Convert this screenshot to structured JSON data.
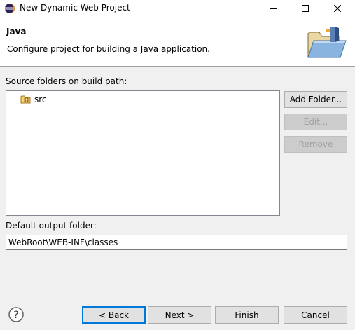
{
  "window": {
    "title": "New Dynamic Web Project",
    "icon": "eclipse-icon",
    "controls": [
      "minimize-icon",
      "maximize-icon",
      "close-icon"
    ]
  },
  "header": {
    "title": "Java",
    "description": "Configure project for building a Java application.",
    "image": "java-folder-icon"
  },
  "source": {
    "label": "Source folders on build path:",
    "items": [
      {
        "label": "src",
        "icon": "package-folder-icon"
      }
    ]
  },
  "buttons": {
    "add_folder": "Add Folder...",
    "edit": "Edit...",
    "remove": "Remove"
  },
  "output": {
    "label": "Default output folder:",
    "value": "WebRoot\\WEB-INF\\classes"
  },
  "footer": {
    "help_icon": "help-icon",
    "back": "< Back",
    "next": "Next >",
    "finish": "Finish",
    "cancel": "Cancel"
  }
}
